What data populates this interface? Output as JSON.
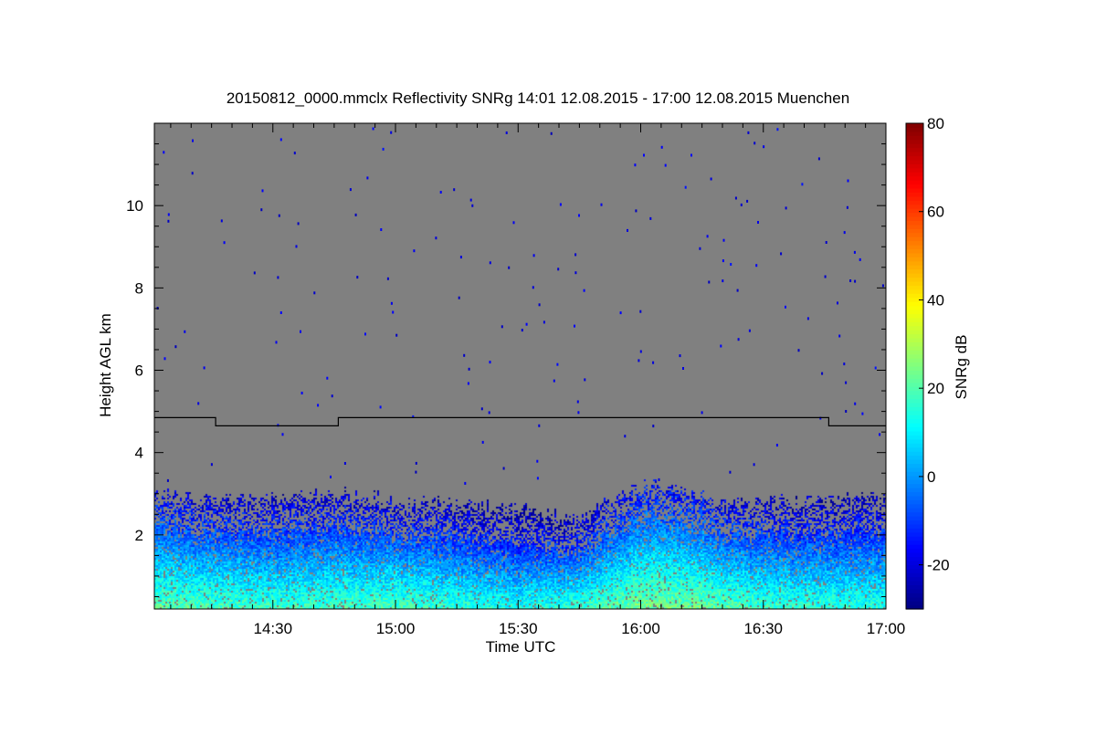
{
  "chart_data": {
    "type": "heatmap",
    "title": "20150812_0000.mmclx Reflectivity SNRg   14:01 12.08.2015 - 17:00 12.08.2015 Muenchen",
    "xlabel": "Time UTC",
    "ylabel": "Height AGL km",
    "x_range": [
      "14:01",
      "17:00"
    ],
    "x_ticks": [
      "14:30",
      "15:00",
      "15:30",
      "16:00",
      "16:30",
      "17:00"
    ],
    "y_range": [
      0.2,
      12.0
    ],
    "y_ticks": [
      2,
      4,
      6,
      8,
      10
    ],
    "background_value": "no signal",
    "background_color": "#808080",
    "colorbar": {
      "label": "SNRg dB",
      "range": [
        -30,
        80
      ],
      "ticks": [
        -20,
        0,
        20,
        40,
        60,
        80
      ],
      "colormap": "jet"
    },
    "overlay_line": {
      "description": "step line",
      "color": "#000000",
      "points": [
        {
          "time": "14:01",
          "height": 4.85
        },
        {
          "time": "14:16",
          "height": 4.85
        },
        {
          "time": "14:16",
          "height": 4.65
        },
        {
          "time": "14:46",
          "height": 4.65
        },
        {
          "time": "14:46",
          "height": 4.85
        },
        {
          "time": "16:46",
          "height": 4.85
        },
        {
          "time": "16:46",
          "height": 4.65
        },
        {
          "time": "17:00",
          "height": 4.65
        }
      ]
    },
    "echo_layer": {
      "description": "boundary layer echo top (approx. height in km of signal top vs time)",
      "top_profile": [
        {
          "time": "14:01",
          "height": 2.8
        },
        {
          "time": "14:15",
          "height": 2.6
        },
        {
          "time": "14:30",
          "height": 2.7
        },
        {
          "time": "14:45",
          "height": 2.8
        },
        {
          "time": "15:00",
          "height": 2.6
        },
        {
          "time": "15:15",
          "height": 2.5
        },
        {
          "time": "15:30",
          "height": 2.4
        },
        {
          "time": "15:45",
          "height": 2.2
        },
        {
          "time": "16:00",
          "height": 3.0
        },
        {
          "time": "16:10",
          "height": 2.9
        },
        {
          "time": "16:20",
          "height": 2.5
        },
        {
          "time": "16:30",
          "height": 2.6
        },
        {
          "time": "16:45",
          "height": 2.6
        },
        {
          "time": "17:00",
          "height": 2.7
        }
      ],
      "snr_near_surface_db": [
        {
          "time": "14:01",
          "value": 22
        },
        {
          "time": "14:30",
          "value": 18
        },
        {
          "time": "15:00",
          "value": 20
        },
        {
          "time": "15:30",
          "value": 14
        },
        {
          "time": "15:45",
          "value": 18
        },
        {
          "time": "16:00",
          "value": 25
        },
        {
          "time": "16:15",
          "value": 24
        },
        {
          "time": "16:30",
          "value": 18
        },
        {
          "time": "17:00",
          "value": 16
        }
      ]
    }
  }
}
